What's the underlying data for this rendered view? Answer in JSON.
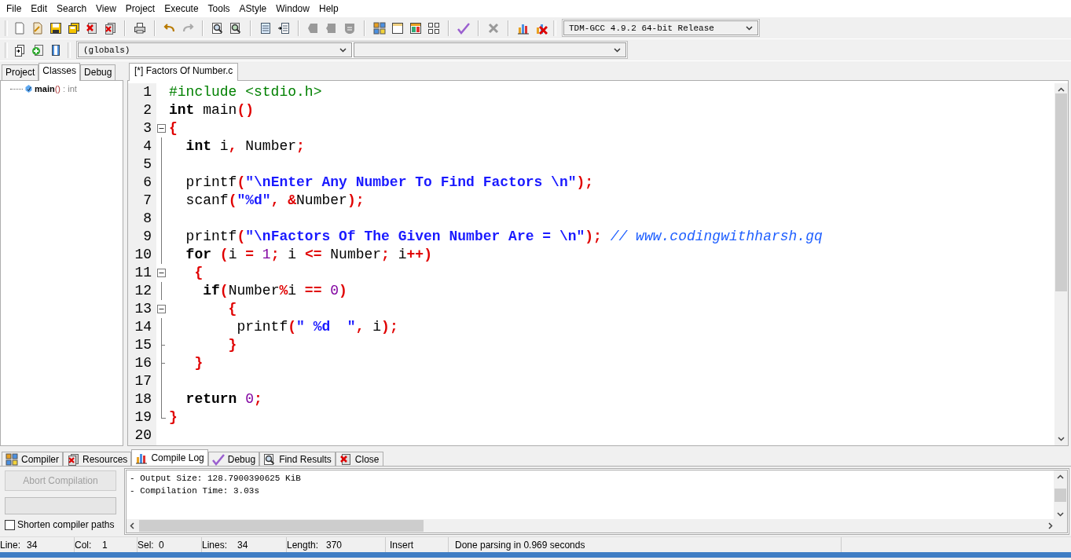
{
  "menu": [
    "File",
    "Edit",
    "Search",
    "View",
    "Project",
    "Execute",
    "Tools",
    "AStyle",
    "Window",
    "Help"
  ],
  "compiler_select": {
    "value": "TDM-GCC 4.9.2 64-bit Release"
  },
  "scope_select": {
    "value": "(globals)"
  },
  "left_tabs": [
    {
      "label": "Project",
      "selected": false
    },
    {
      "label": "Classes",
      "selected": true
    },
    {
      "label": "Debug",
      "selected": false
    }
  ],
  "class_tree": [
    {
      "name": "main",
      "signature": "()",
      "type": ": int"
    }
  ],
  "editor_tabs": [
    {
      "label": "[*] Factors Of Number.c",
      "selected": true
    }
  ],
  "code_lines": [
    {
      "number": "1",
      "kind": "plain",
      "tokens": [
        {
          "kind": "preprocessor",
          "text": "#include <stdio.h>"
        }
      ]
    },
    {
      "number": "2",
      "kind": "plain",
      "tokens": [
        {
          "kind": "keyword",
          "text": "int"
        },
        {
          "kind": "plain",
          "text": " main"
        },
        {
          "kind": "operator",
          "text": "()"
        }
      ]
    },
    {
      "number": "3",
      "kind": "foldstart",
      "expanded": true,
      "tokens": [
        {
          "kind": "operator",
          "text": "{"
        }
      ]
    },
    {
      "number": "4",
      "kind": "inside",
      "tokens": [
        {
          "kind": "keyword",
          "text": "  int"
        },
        {
          "kind": "plain",
          "text": " i"
        },
        {
          "kind": "operator",
          "text": ","
        },
        {
          "kind": "plain",
          "text": " Number"
        },
        {
          "kind": "operator",
          "text": ";"
        }
      ]
    },
    {
      "number": "5",
      "kind": "inside"
    },
    {
      "number": "6",
      "kind": "inside",
      "tokens": [
        {
          "kind": "plain",
          "text": "  printf"
        },
        {
          "kind": "operator",
          "text": "("
        },
        {
          "kind": "string",
          "text": "\"\\nEnter Any Number To Find Factors \\n\""
        },
        {
          "kind": "operator",
          "text": ");"
        }
      ]
    },
    {
      "number": "7",
      "kind": "inside",
      "tokens": [
        {
          "kind": "plain",
          "text": "  scanf"
        },
        {
          "kind": "operator",
          "text": "("
        },
        {
          "kind": "string",
          "text": "\"%d\""
        },
        {
          "kind": "operator",
          "text": ", &"
        },
        {
          "kind": "plain",
          "text": "Number"
        },
        {
          "kind": "operator",
          "text": ");"
        }
      ]
    },
    {
      "number": "8",
      "kind": "inside"
    },
    {
      "number": "9",
      "kind": "inside",
      "tokens": [
        {
          "kind": "plain",
          "text": "  printf"
        },
        {
          "kind": "operator",
          "text": "("
        },
        {
          "kind": "string",
          "text": "\"\\nFactors Of The Given Number Are = \\n\""
        },
        {
          "kind": "operator",
          "text": "); "
        },
        {
          "kind": "comment",
          "text": "// www.codingwithharsh.gq"
        }
      ]
    },
    {
      "number": "10",
      "kind": "inside",
      "tokens": [
        {
          "kind": "keyword",
          "text": "  for"
        },
        {
          "kind": "operator",
          "text": " ("
        },
        {
          "kind": "plain",
          "text": "i "
        },
        {
          "kind": "operator",
          "text": "= "
        },
        {
          "kind": "number",
          "text": "1"
        },
        {
          "kind": "operator",
          "text": ";"
        },
        {
          "kind": "plain",
          "text": " i "
        },
        {
          "kind": "operator",
          "text": "<="
        },
        {
          "kind": "plain",
          "text": " Number"
        },
        {
          "kind": "operator",
          "text": ";"
        },
        {
          "kind": "plain",
          "text": " i"
        },
        {
          "kind": "operator",
          "text": "++)"
        }
      ]
    },
    {
      "number": "11",
      "kind": "foldstart",
      "expanded": true,
      "tokens": [
        {
          "kind": "operator",
          "text": "   {"
        }
      ]
    },
    {
      "number": "12",
      "kind": "inside",
      "tokens": [
        {
          "kind": "keyword",
          "text": "    if"
        },
        {
          "kind": "operator",
          "text": "("
        },
        {
          "kind": "plain",
          "text": "Number"
        },
        {
          "kind": "operator",
          "text": "%"
        },
        {
          "kind": "plain",
          "text": "i "
        },
        {
          "kind": "operator",
          "text": "== "
        },
        {
          "kind": "number",
          "text": "0"
        },
        {
          "kind": "operator",
          "text": ")"
        }
      ]
    },
    {
      "number": "13",
      "kind": "foldstart",
      "expanded": true,
      "tokens": [
        {
          "kind": "operator",
          "text": "       {"
        }
      ]
    },
    {
      "number": "14",
      "kind": "inside",
      "tokens": [
        {
          "kind": "plain",
          "text": "        printf"
        },
        {
          "kind": "operator",
          "text": "("
        },
        {
          "kind": "string",
          "text": "\" %d  \""
        },
        {
          "kind": "operator",
          "text": ","
        },
        {
          "kind": "plain",
          "text": " i"
        },
        {
          "kind": "operator",
          "text": ");"
        }
      ]
    },
    {
      "number": "15",
      "kind": "innerend",
      "tokens": [
        {
          "kind": "operator",
          "text": "       }"
        }
      ]
    },
    {
      "number": "16",
      "kind": "innerend",
      "tokens": [
        {
          "kind": "operator",
          "text": "   }"
        }
      ]
    },
    {
      "number": "17",
      "kind": "inside"
    },
    {
      "number": "18",
      "kind": "inside",
      "tokens": [
        {
          "kind": "keyword",
          "text": "  return"
        },
        {
          "kind": "number",
          "text": " 0"
        },
        {
          "kind": "operator",
          "text": ";"
        }
      ]
    },
    {
      "number": "19",
      "kind": "foldend",
      "tokens": [
        {
          "kind": "operator",
          "text": "}"
        }
      ]
    },
    {
      "number": "20",
      "kind": "plain"
    }
  ],
  "bottom_tabs": [
    {
      "label": "Compiler",
      "selected": false
    },
    {
      "label": "Resources",
      "selected": false
    },
    {
      "label": "Compile Log",
      "selected": true
    },
    {
      "label": "Debug",
      "selected": false
    },
    {
      "label": "Find Results",
      "selected": false
    },
    {
      "label": "Close",
      "selected": false
    }
  ],
  "abort_button": {
    "label": "Abort Compilation",
    "disabled": true
  },
  "progress": {
    "level": 0
  },
  "shorten_paths": {
    "label": "Shorten compiler paths",
    "checked": false
  },
  "log": [
    "- Output Size: 128.7900390625 KiB",
    "- Compilation Time: 3.03s"
  ],
  "status_bar": [
    {
      "label": "Line:",
      "value": "34"
    },
    {
      "label": "Col:",
      "value": "1"
    },
    {
      "label": "Sel:",
      "value": "0"
    },
    {
      "label": "Lines:",
      "value": "34"
    },
    {
      "label": "Length:",
      "value": "370"
    },
    {
      "value": "Insert"
    },
    {
      "value": "Done parsing in 0.969 seconds"
    }
  ]
}
